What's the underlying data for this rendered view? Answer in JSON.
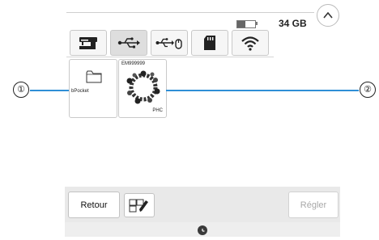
{
  "storage": {
    "free_text": "34 GB",
    "level": 0.45
  },
  "tabs": [
    {
      "name": "machine-memory",
      "icon": "sewing-machine-icon",
      "active": false
    },
    {
      "name": "usb-port-1",
      "icon": "usb-icon",
      "active": true
    },
    {
      "name": "usb-port-2",
      "icon": "usb-mouse-icon",
      "active": false
    },
    {
      "name": "sd-card",
      "icon": "sd-card-icon",
      "active": false
    },
    {
      "name": "wireless",
      "icon": "wifi-icon",
      "active": false
    }
  ],
  "files": [
    {
      "type": "folder",
      "icon": "folder-icon",
      "label": "bPocket"
    },
    {
      "type": "design",
      "icon": "wreath-design-icon",
      "name": "EM999999",
      "format": "PHC"
    }
  ],
  "callouts": [
    {
      "number": "①"
    },
    {
      "number": "②"
    }
  ],
  "footer": {
    "back_label": "Retour",
    "edit_icon": "edit-list-icon",
    "set_label": "Régler",
    "clock_icon": "clock-icon"
  },
  "colors": {
    "callout_line": "#2f8fd6"
  }
}
